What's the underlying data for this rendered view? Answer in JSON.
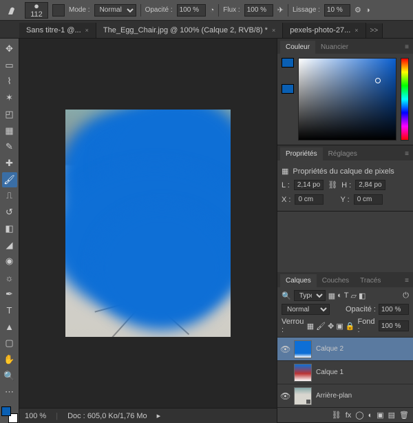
{
  "options_bar": {
    "brush_size": "112",
    "mode_label": "Mode :",
    "mode_value": "Normal",
    "opacity_label": "Opacité :",
    "opacity_value": "100 %",
    "flux_label": "Flux :",
    "flux_value": "100 %",
    "smoothing_label": "Lissage :",
    "smoothing_value": "10 %"
  },
  "tabs": {
    "items": [
      {
        "label": "Sans titre-1 @...",
        "active": false
      },
      {
        "label": "The_Egg_Chair.jpg @ 100% (Calque 2, RVB/8) *",
        "active": true
      },
      {
        "label": "pexels-photo-27...",
        "active": false
      }
    ],
    "overflow": ">>"
  },
  "status": {
    "zoom": "100 %",
    "doc_label": "Doc :",
    "doc_value": "605,0 Ko/1,76 Mo"
  },
  "colors": {
    "foreground": "#0a5fb3",
    "background": "#ffffff"
  },
  "panel_color": {
    "tab_color": "Couleur",
    "tab_swatches": "Nuancier"
  },
  "panel_props": {
    "tab_props": "Propriétés",
    "tab_adjust": "Réglages",
    "title": "Propriétés du calque de pixels",
    "w_label": "L :",
    "w_value": "2,14 po",
    "link_icon": "⛓",
    "h_label": "H :",
    "h_value": "2,84 po",
    "x_label": "X :",
    "x_value": "0 cm",
    "y_label": "Y :",
    "y_value": "0 cm"
  },
  "panel_layers": {
    "tab_layers": "Calques",
    "tab_channels": "Couches",
    "tab_paths": "Tracés",
    "type_search_placeholder": "Type",
    "blend_mode": "Normal",
    "opacity_label": "Opacité :",
    "opacity_value": "100 %",
    "lock_label": "Verrou :",
    "fill_label": "Fond :",
    "fill_value": "100 %",
    "layers": [
      {
        "name": "Calque 2",
        "visible": true,
        "selected": true,
        "thumb": "blue"
      },
      {
        "name": "Calque 1",
        "visible": false,
        "selected": false,
        "thumb": "red"
      },
      {
        "name": "Arrière-plan",
        "visible": true,
        "selected": false,
        "thumb": "bg"
      }
    ]
  }
}
